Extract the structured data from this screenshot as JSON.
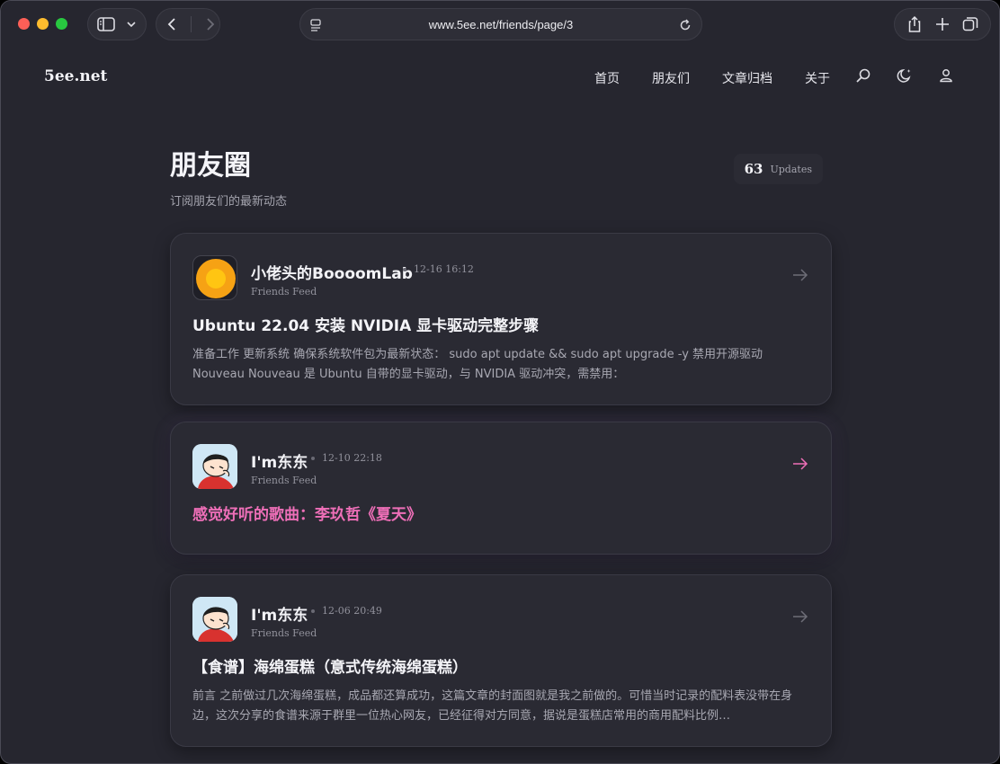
{
  "browser": {
    "url": "www.5ee.net/friends/page/3"
  },
  "site": {
    "logo": "5ee.net",
    "menu": [
      "首页",
      "朋友们",
      "文章归档",
      "关于"
    ]
  },
  "page": {
    "title": "朋友圈",
    "subtitle": "订阅朋友们的最新动态",
    "count": "63",
    "count_label": "Updates"
  },
  "posts": [
    {
      "author": "小佬头的BoooomLab",
      "time": "12-16 16:12",
      "feed": "Friends Feed",
      "title": "Ubuntu 22.04 安装 NVIDIA 显卡驱动完整步骤",
      "excerpt": "准备工作 更新系统 确保系统软件包为最新状态： sudo apt update && sudo apt upgrade -y 禁用开源驱动 Nouveau Nouveau 是 Ubuntu 自带的显卡驱动，与 NVIDIA 驱动冲突，需禁用："
    },
    {
      "author": "I'm东东",
      "time": "12-10 22:18",
      "feed": "Friends Feed",
      "title": "感觉好听的歌曲：李玖哲《夏天》",
      "excerpt": ""
    },
    {
      "author": "I'm东东",
      "time": "12-06 20:49",
      "feed": "Friends Feed",
      "title": "【食谱】海绵蛋糕（意式传统海绵蛋糕）",
      "excerpt": "前言 之前做过几次海绵蛋糕，成品都还算成功，这篇文章的封面图就是我之前做的。可惜当时记录的配料表没带在身边，这次分享的食谱来源于群里一位热心网友，已经征得对方同意，据说是蛋糕店常用的商用配料比例…"
    }
  ],
  "colors": {
    "background": "#26262f",
    "card": "#2a2a33",
    "accent_pink": "#ee6fb8",
    "muted_text": "#a8a8b2"
  }
}
